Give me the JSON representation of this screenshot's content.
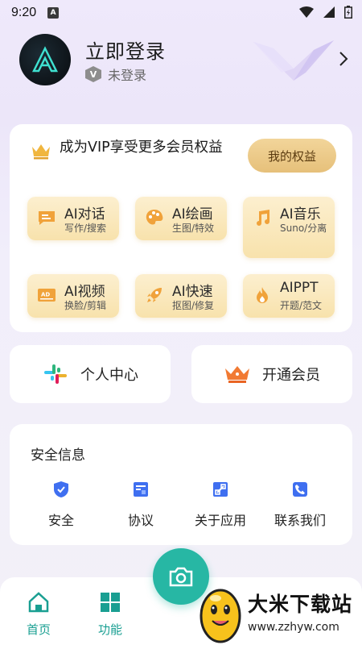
{
  "status_bar": {
    "time": "9:20",
    "indicator": "A"
  },
  "profile": {
    "title": "立即登录",
    "badge": "V",
    "status": "未登录"
  },
  "vip": {
    "promo": "成为VIP享受更多会员权益",
    "rights_button": "我的权益",
    "tools": [
      {
        "name": "AI对话",
        "desc": "写作/搜索",
        "icon": "chat-icon"
      },
      {
        "name": "AI绘画",
        "desc": "生图/特效",
        "icon": "palette-icon"
      },
      {
        "name": "AI音乐",
        "desc": "Suno/分离",
        "icon": "music-icon"
      },
      {
        "name": "AI视频",
        "desc": "换脸/剪辑",
        "icon": "video-ad-icon"
      },
      {
        "name": "AI快速",
        "desc": "抠图/修复",
        "icon": "rocket-icon"
      },
      {
        "name": "AIPPT",
        "desc": "开题/范文",
        "icon": "flame-icon"
      }
    ]
  },
  "quick": {
    "personal": "个人中心",
    "vip_open": "开通会员"
  },
  "security": {
    "title": "安全信息",
    "items": [
      {
        "label": "安全",
        "icon": "shield-icon"
      },
      {
        "label": "协议",
        "icon": "document-icon"
      },
      {
        "label": "关于应用",
        "icon": "link-icon"
      },
      {
        "label": "联系我们",
        "icon": "phone-icon"
      }
    ]
  },
  "nav": {
    "home": "首页",
    "functions": "功能"
  },
  "watermark": {
    "title": "大米下载站",
    "url": "www.zzhyw.com"
  },
  "colors": {
    "accent": "#27b7a4",
    "gold": "#e6c07a",
    "tool_bg": "#f8e2ac"
  }
}
